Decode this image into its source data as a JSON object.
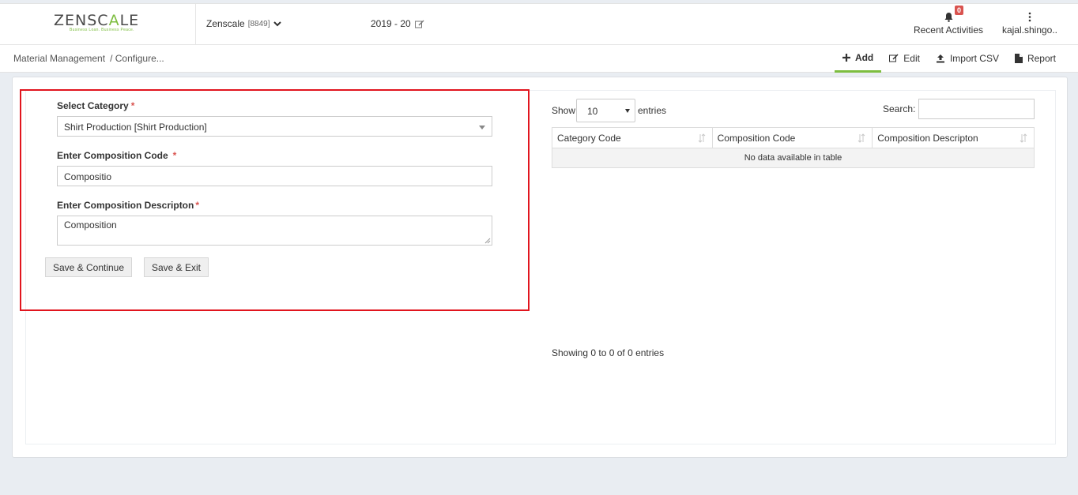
{
  "header": {
    "logo": {
      "text_a": "ZENSC",
      "text_b": "A",
      "text_c": "LE",
      "tagline": "Business Loan. Business Peace."
    },
    "company": {
      "name": "Zenscale",
      "code": "[8849]"
    },
    "fiscal_year": "2019 - 20",
    "recent_activities": {
      "label": "Recent Activities",
      "count": "0"
    },
    "user": {
      "name": "kajal.shingo.."
    }
  },
  "breadcrumb": {
    "root": "Material Management",
    "current": "/ Configure..."
  },
  "actions": {
    "add": "Add",
    "edit": "Edit",
    "import_csv": "Import CSV",
    "report": "Report"
  },
  "form": {
    "category": {
      "label": "Select Category",
      "required": "*",
      "value": "Shirt Production [Shirt Production]"
    },
    "code": {
      "label": "Enter Composition Code",
      "required": "*",
      "value": "Compositio"
    },
    "description": {
      "label": "Enter Composition Descripton",
      "required": "*",
      "value": "Composition"
    },
    "save_continue": "Save & Continue",
    "save_exit": "Save & Exit"
  },
  "table": {
    "show_label": "Show",
    "page_length": "10",
    "entries_label": "entries",
    "search_label": "Search:",
    "columns": [
      "Category Code",
      "Composition Code",
      "Composition Descripton"
    ],
    "empty_message": "No data available in table",
    "info": "Showing 0 to 0 of 0 entries"
  },
  "colors": {
    "accent": "#7dbd3f",
    "highlight_box": "#e1151e",
    "badge": "#d9534f"
  }
}
